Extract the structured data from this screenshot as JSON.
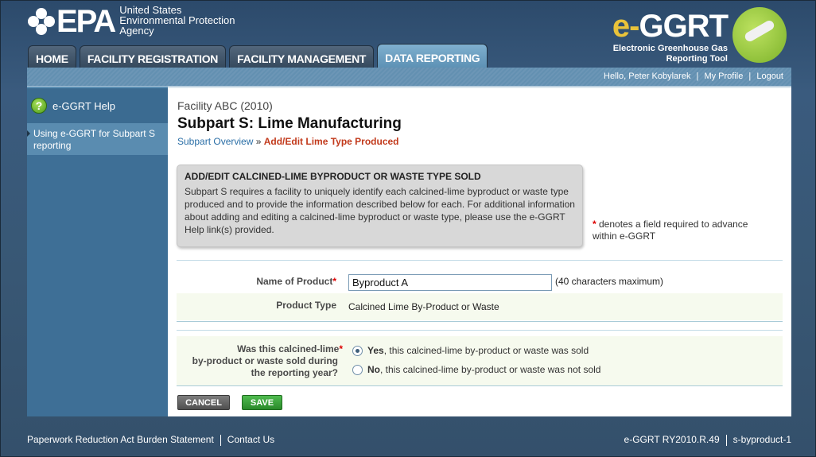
{
  "header": {
    "epa_mark": "EPA",
    "epa_lines": [
      "United States",
      "Environmental Protection",
      "Agency"
    ],
    "app_logo_prefix": "e-",
    "app_logo_name": "GGRT",
    "app_subtitle_1": "Electronic Greenhouse Gas",
    "app_subtitle_2": "Reporting Tool"
  },
  "nav": {
    "tabs": [
      {
        "label": "HOME"
      },
      {
        "label": "FACILITY REGISTRATION"
      },
      {
        "label": "FACILITY MANAGEMENT"
      },
      {
        "label": "DATA REPORTING"
      }
    ]
  },
  "userbar": {
    "greeting": "Hello, Peter Kobylarek",
    "my_profile": "My Profile",
    "logout": "Logout"
  },
  "sidebar": {
    "help": "e-GGRT Help",
    "link": "Using e-GGRT for Subpart S reporting"
  },
  "main": {
    "facility": "Facility ABC (2010)",
    "title": "Subpart S: Lime Manufacturing",
    "breadcrumb_link": "Subpart Overview",
    "breadcrumb_sep": " » ",
    "breadcrumb_current": "Add/Edit Lime Type Produced",
    "info_title": "ADD/EDIT CALCINED-LIME BYPRODUCT OR WASTE TYPE SOLD",
    "info_text": "Subpart S requires a facility to uniquely identify each calcined-lime byproduct or waste type produced and to provide the information described below for each. For additional information about adding and editing a calcined-lime byproduct or waste type, please use the e-GGRT Help link(s) provided.",
    "required_note": " denotes a field required to advance within e-GGRT",
    "required_star": "*"
  },
  "form": {
    "name_label": "Name of Product",
    "name_value": "Byproduct A",
    "name_hint": "(40 characters maximum)",
    "type_label": "Product Type",
    "type_value": "Calcined Lime By-Product or Waste",
    "sold_label_1": "Was this calcined-lime",
    "sold_label_2": "by-product or waste sold during",
    "sold_label_3": "the reporting year?",
    "yes_bold": "Yes",
    "yes_text": ", this calcined-lime by-product or waste was sold",
    "no_bold": "No",
    "no_text": ", this calcined-lime by-product or waste was not sold",
    "cancel": "CANCEL",
    "save": "SAVE"
  },
  "footer": {
    "paperwork": "Paperwork Reduction Act Burden Statement",
    "contact": "Contact Us",
    "version": "e-GGRT RY2010.R.49",
    "page_id": "s-byproduct-1"
  }
}
